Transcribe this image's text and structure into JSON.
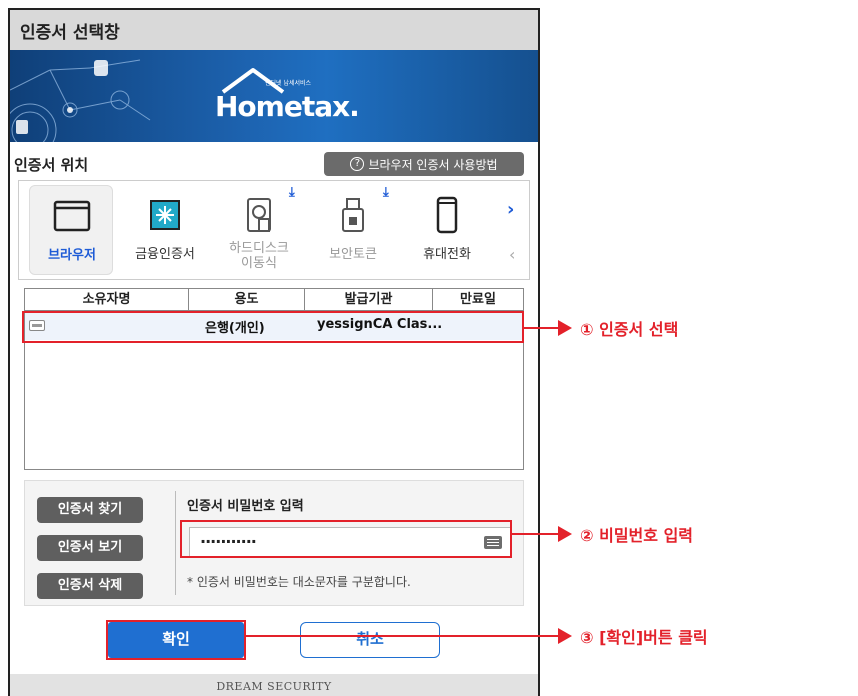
{
  "window": {
    "title": "인증서 선택창"
  },
  "banner": {
    "logo_word": "Hometax.",
    "logo_sub": "인터넷 납세서비스"
  },
  "location": {
    "title": "인증서 위치",
    "help_label": "브라우저 인증서 사용방법"
  },
  "stores": [
    {
      "label": "브라우저"
    },
    {
      "label": "금융인증서"
    },
    {
      "label": "하드디스크\n이동식"
    },
    {
      "label": "보안토큰"
    },
    {
      "label": "휴대전화"
    }
  ],
  "cert_list": {
    "headers": [
      "소유자명",
      "용도",
      "발급기관",
      "만료일"
    ],
    "rows": [
      {
        "owner": "",
        "usage": "은행(개인)",
        "issuer": "yessignCA Clas...",
        "expiry": ""
      }
    ]
  },
  "actions": {
    "find": "인증서 찾기",
    "view": "인증서 보기",
    "delete": "인증서 삭제"
  },
  "password": {
    "label": "인증서 비밀번호 입력",
    "value": "···········",
    "hint": "* 인증서 비밀번호는 대소문자를 구분합니다."
  },
  "buttons": {
    "ok": "확인",
    "cancel": "취소"
  },
  "footer": {
    "brand": "DREAM SECURITY"
  },
  "annotations": {
    "step1": "① 인증서 선택",
    "step2": "② 비밀번호 입력",
    "step3": "③ [확인]버튼 클릭"
  },
  "colors": {
    "accent": "#1f6fd1",
    "callout": "#e3212a",
    "banner": "#1d63b0"
  }
}
